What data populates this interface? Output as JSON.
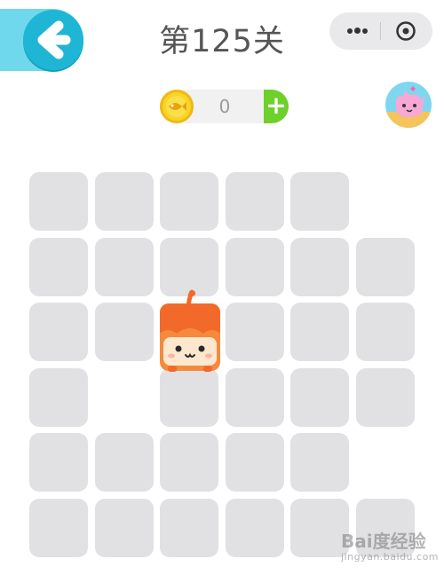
{
  "header": {
    "level_title": "第125关",
    "back_icon": "arrow-left-icon",
    "menu_icon": "more-dots-icon",
    "close_icon": "target-circle-icon"
  },
  "coins": {
    "count": "0",
    "icon": "fish-coin-icon",
    "add_label": "+"
  },
  "avatar": {
    "icon": "pink-cat-avatar-icon"
  },
  "board": {
    "rows": [
      [
        1,
        1,
        1,
        1,
        1,
        0
      ],
      [
        1,
        1,
        1,
        1,
        1,
        1
      ],
      [
        1,
        1,
        2,
        1,
        1,
        1
      ],
      [
        1,
        0,
        1,
        1,
        1,
        1
      ],
      [
        1,
        1,
        1,
        1,
        1,
        0
      ],
      [
        1,
        1,
        1,
        1,
        1,
        1
      ]
    ],
    "legend": "1 = empty tile, 0 = gap, 2 = cat",
    "tile_color": "#e1e1e4",
    "cat_color": "#f26a2a"
  },
  "watermark": {
    "logo": "Bai度经验",
    "url": "jingyan.baidu.com"
  }
}
